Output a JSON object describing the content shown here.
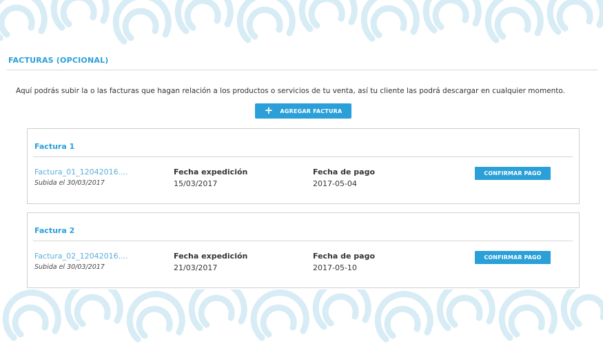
{
  "section": {
    "title": "FACTURAS (OPCIONAL)",
    "intro": "Aquí podrás subir la o las facturas que hagan relación a los productos o servicios de tu venta, así tu cliente las podrá descargar en cualquier momento.",
    "add_button_label": "AGREGAR FACTURA",
    "add_button_icon": "+"
  },
  "invoices": [
    {
      "title": "Factura 1",
      "file_name": "Factura_01_12042016....",
      "uploaded": "Subida el 30/03/2017",
      "issue_label": "Fecha expedición",
      "issue_date": "15/03/2017",
      "payment_label": "Fecha de pago",
      "payment_date": "2017-05-04",
      "confirm_label": "CONFIRMAR PAGO"
    },
    {
      "title": "Factura 2",
      "file_name": "Factura_02_12042016....",
      "uploaded": "Subida el 30/03/2017",
      "issue_label": "Fecha expedición",
      "issue_date": "21/03/2017",
      "payment_label": "Fecha de pago",
      "payment_date": "2017-05-10",
      "confirm_label": "CONFIRMAR PAGO"
    }
  ],
  "colors": {
    "accent": "#2a9fd8",
    "link": "#5aaedb",
    "pattern": "#d7ecf5"
  }
}
